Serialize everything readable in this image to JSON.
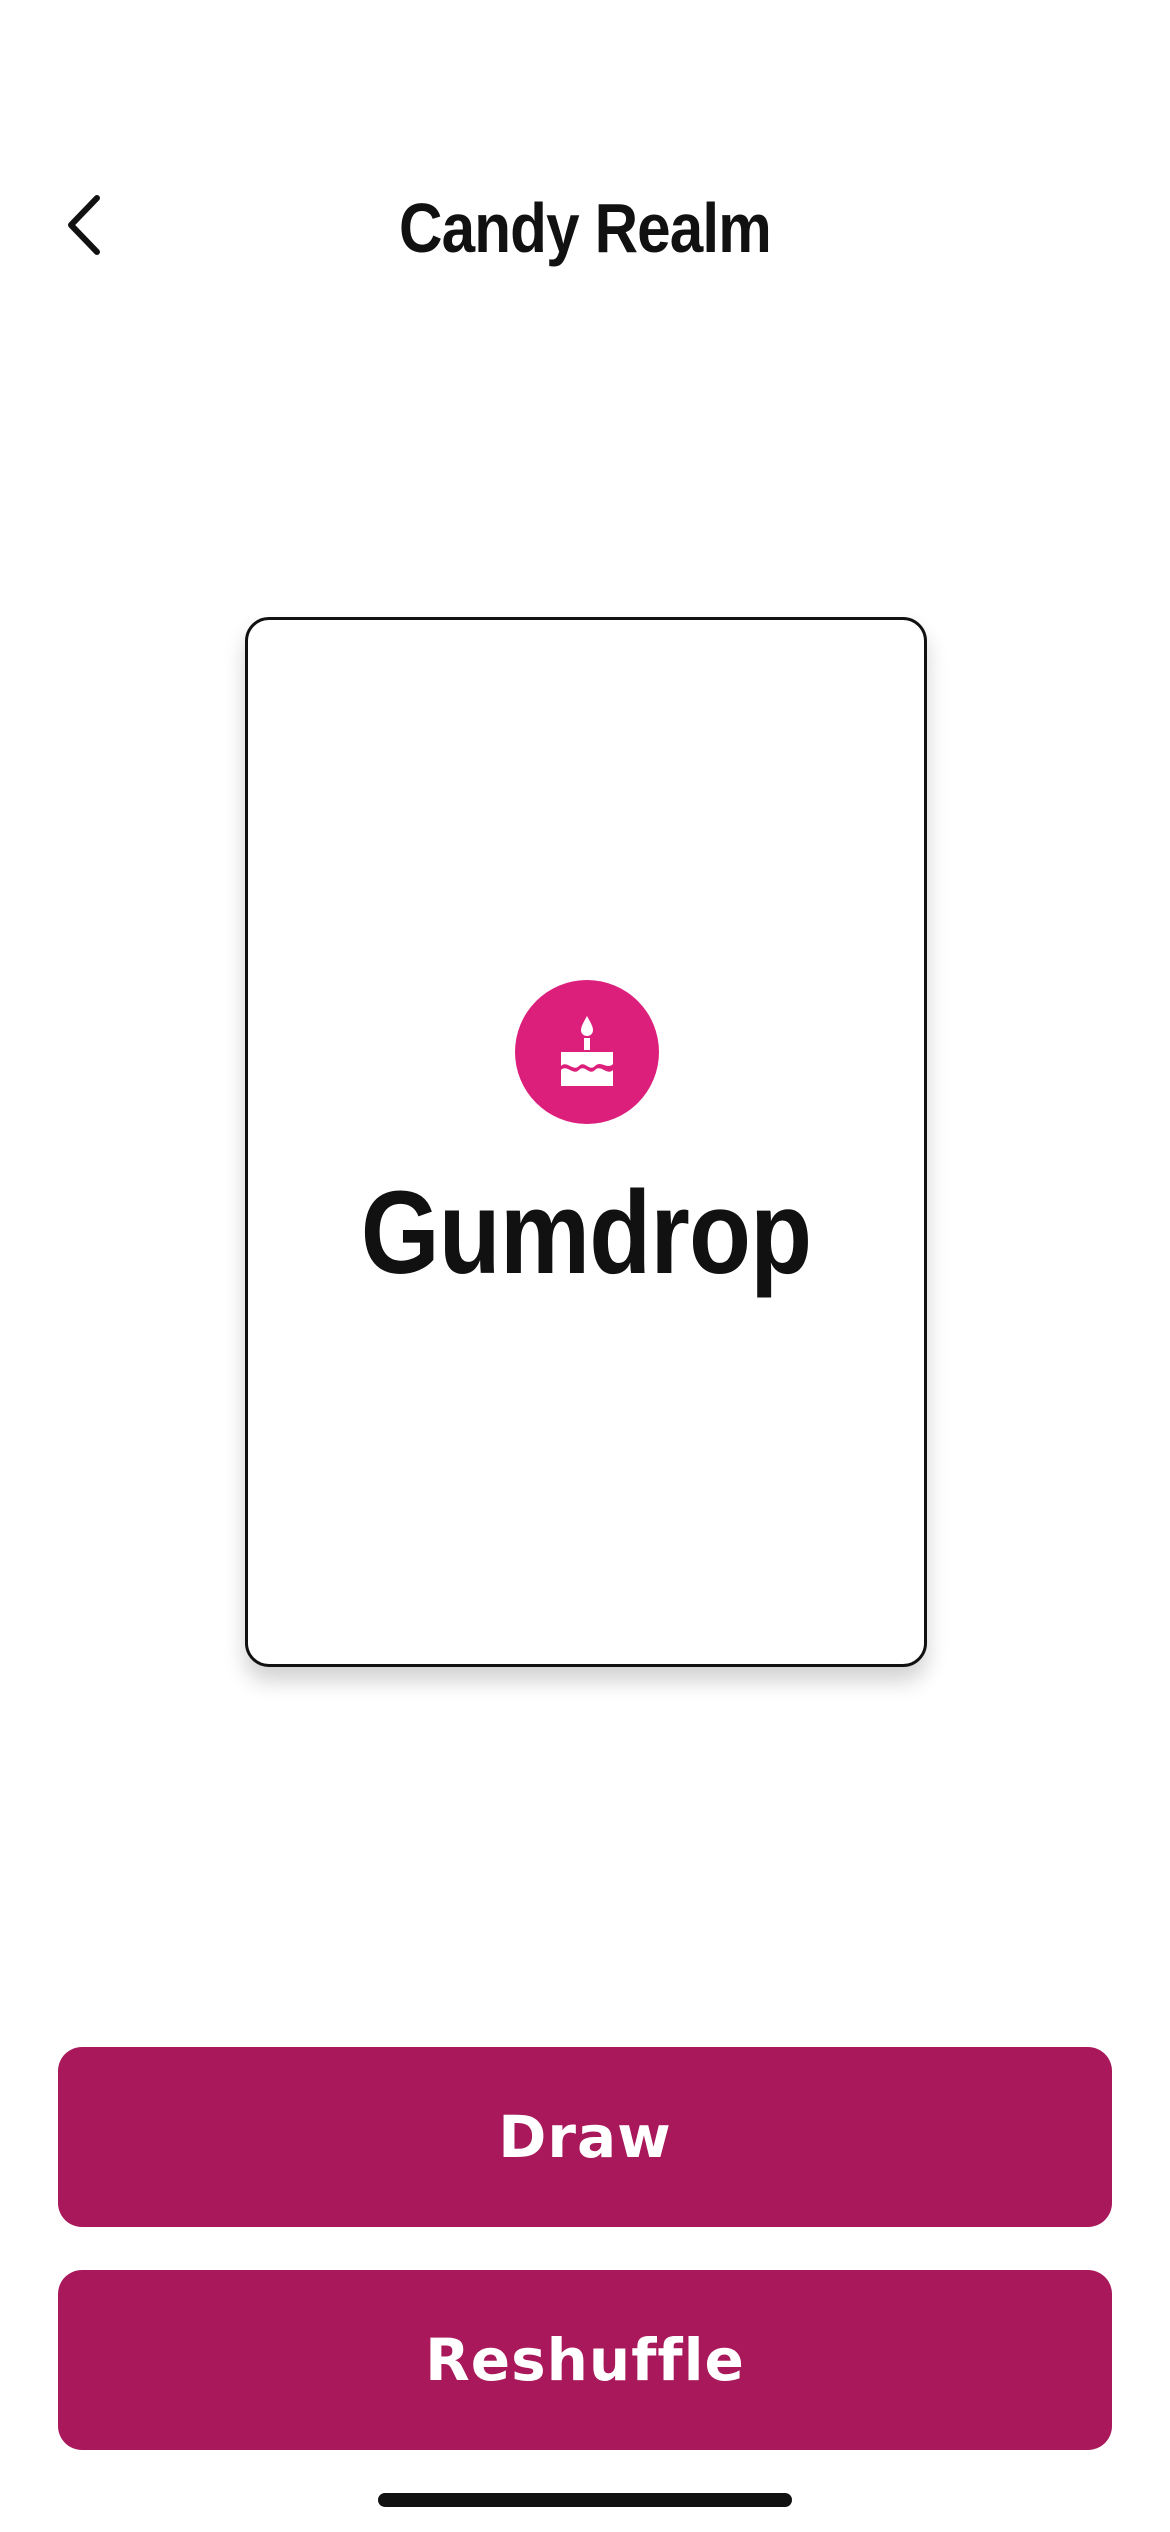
{
  "header": {
    "title": "Candy Realm",
    "back_icon": "chevron-left-icon"
  },
  "card": {
    "icon": "cake-icon",
    "icon_color": "#dc1f7b",
    "word": "Gumdrop"
  },
  "actions": {
    "draw_label": "Draw",
    "reshuffle_label": "Reshuffle",
    "button_color": "#a8185a"
  }
}
